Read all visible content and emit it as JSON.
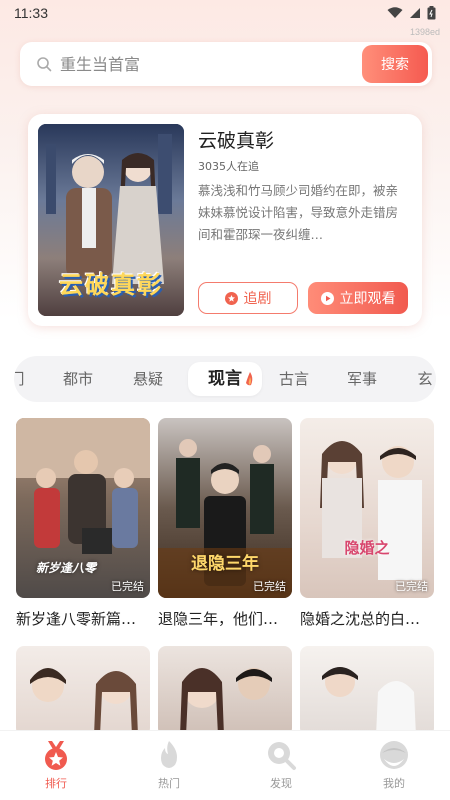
{
  "status_bar": {
    "time": "11:33",
    "sub_label": "1398ed"
  },
  "search": {
    "placeholder": "重生当首富",
    "button_label": "搜索"
  },
  "featured": {
    "title": "云破真彰",
    "poster_art_text": "云破真彰",
    "followers": "3035人在追",
    "description": "慕浅浅和竹马顾少司婚约在即，被亲妹妹慕悦设计陷害，导致意外走错房间和霍邵琛一夜纠缠…",
    "follow_label": "追剧",
    "watch_label": "立即观看"
  },
  "tabs": [
    {
      "label": "门"
    },
    {
      "label": "都市"
    },
    {
      "label": "悬疑"
    },
    {
      "label": "现言"
    },
    {
      "label": "古言"
    },
    {
      "label": "军事"
    },
    {
      "label": "玄"
    }
  ],
  "active_tab_index": 3,
  "dramas": [
    {
      "title": "新岁逢八零新篇…",
      "status": "已完结",
      "art_text": "新岁逢八零"
    },
    {
      "title": "退隐三年，他们…",
      "status": "已完结",
      "art_text": "退隐三年"
    },
    {
      "title": "隐婚之沈总的白…",
      "status": "已完结",
      "art_text": "隐婚之"
    },
    {
      "title": "",
      "status": "",
      "art_text": ""
    },
    {
      "title": "",
      "status": "",
      "art_text": ""
    },
    {
      "title": "",
      "status": "",
      "art_text": ""
    }
  ],
  "bottom_nav": [
    {
      "label": "排行",
      "icon": "ranking-medal-icon"
    },
    {
      "label": "热门",
      "icon": "flame-icon"
    },
    {
      "label": "发现",
      "icon": "discover-search-icon"
    },
    {
      "label": "我的",
      "icon": "profile-face-icon"
    }
  ],
  "colors": {
    "accent": "#f05a4f",
    "accent_light": "#ff8f7a",
    "tab_bg": "#f3f3f5"
  }
}
